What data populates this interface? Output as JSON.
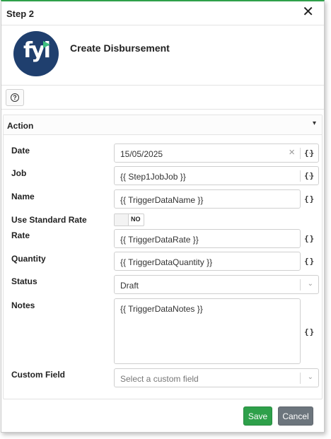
{
  "dialog": {
    "title": "Step 2",
    "close_icon": "close-icon (×)"
  },
  "header": {
    "logo_text": "fyi",
    "title": "Create Disbursement"
  },
  "help": {
    "icon": "question-circle-icon",
    "glyph": "?"
  },
  "action": {
    "title": "Action",
    "collapse_glyph": "⌄",
    "braces": "{}",
    "fields": {
      "date": {
        "label": "Date",
        "value": "15/05/2025"
      },
      "job": {
        "label": "Job",
        "value": "{{ Step1JobJob }}"
      },
      "name": {
        "label": "Name",
        "value": "{{ TriggerDataName }}"
      },
      "use_standard_rate": {
        "label": "Use Standard Rate",
        "toggle_text": "NO"
      },
      "rate": {
        "label": "Rate",
        "value": "{{ TriggerDataRate }}"
      },
      "quantity": {
        "label": "Quantity",
        "value": "{{ TriggerDataQuantity }}"
      },
      "status": {
        "label": "Status",
        "value": "Draft"
      },
      "notes": {
        "label": "Notes",
        "value": "{{ TriggerDataNotes }}"
      },
      "custom_field": {
        "label": "Custom Field",
        "placeholder": "Select a custom field"
      }
    }
  },
  "footer": {
    "save_label": "Save",
    "cancel_label": "Cancel"
  },
  "colors": {
    "accent": "#2ea04a",
    "logo_bg": "#1f3f6e",
    "cancel_bg": "#6c757d"
  }
}
